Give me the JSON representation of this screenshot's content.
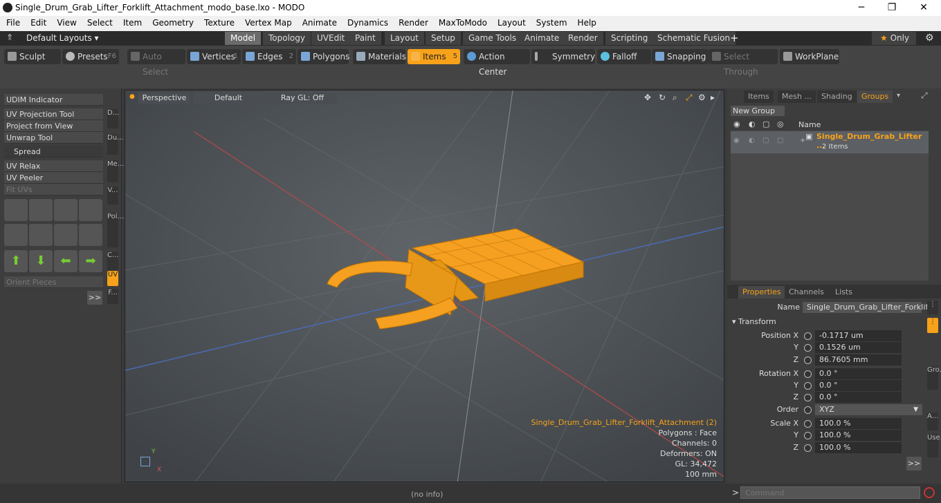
{
  "window": {
    "title": "Single_Drum_Grab_Lifter_Forklift_Attachment_modo_base.lxo - MODO",
    "minimize": "─",
    "maximize": "❐",
    "close": "✕"
  },
  "menu": [
    "File",
    "Edit",
    "View",
    "Select",
    "Item",
    "Geometry",
    "Texture",
    "Vertex Map",
    "Animate",
    "Dynamics",
    "Render",
    "MaxToModo",
    "Layout",
    "System",
    "Help"
  ],
  "layout_menu": "Default Layouts",
  "layout_tabs": [
    "Model",
    "Topology",
    "UVEdit",
    "Paint",
    "Layout",
    "Setup",
    "Game Tools",
    "Animate",
    "Render",
    "Scripting",
    "Schematic Fusion"
  ],
  "add_tab": "+",
  "only_label": "Only",
  "toolbar": {
    "sculpt": "Sculpt",
    "presets": "Presets",
    "presets_key": "F6",
    "auto_select": "Auto Select",
    "vertices": "Vertices",
    "vertices_key": "1",
    "edges": "Edges",
    "edges_key": "2",
    "polygons": "Polygons",
    "materials": "Materials",
    "items": "Items",
    "items_key": "5",
    "action_center": "Action Center",
    "symmetry": "Symmetry",
    "falloff": "Falloff",
    "snapping": "Snapping",
    "select_through": "Select Through",
    "workplane": "WorkPlane"
  },
  "left_tools": {
    "udim": "UDIM Indicator",
    "uv_projection": "UV Projection Tool",
    "project_from_view": "Project from View",
    "unwrap": "Unwrap Tool",
    "spread": "Spread",
    "uv_relax": "UV Relax",
    "uv_peeler": "UV Peeler",
    "fit_uvs": "Fit UVs",
    "orient_pieces": "Orient Pieces",
    "more": ">>"
  },
  "side_tabs": [
    "D...",
    "Du...",
    "Me...",
    "V...",
    "Pol...",
    "C...",
    "UV",
    "F..."
  ],
  "viewport": {
    "perspective": "Perspective",
    "default": "Default",
    "raygl": "Ray GL: Off",
    "selection_name": "Single_Drum_Grab_Lifter_Forklift_Attachment (2)",
    "polygons": "Polygons : Face",
    "channels": "Channels: 0",
    "deformers": "Deformers: ON",
    "gl": "GL: 34,472",
    "scale": "100 mm",
    "axis_y": "Y",
    "axis_x": "X"
  },
  "right_tabs": [
    "Items",
    "Mesh ...",
    "Shading",
    "Groups"
  ],
  "groups": {
    "new_group": "New Group",
    "col_name": "Name",
    "item_name": "Single_Drum_Grab_Lifter ...",
    "item_count": "2 Items"
  },
  "props_tabs": [
    "Properties",
    "Channels",
    "Lists"
  ],
  "properties": {
    "name_label": "Name",
    "name_value": "Single_Drum_Grab_Lifter_Forklift",
    "transform": "Transform",
    "position_x_label": "Position X",
    "position_x": "-0.1717 um",
    "position_y_label": "Y",
    "position_y": "0.1526 um",
    "position_z_label": "Z",
    "position_z": "86.7605 mm",
    "rotation_x_label": "Rotation X",
    "rotation_x": "0.0 °",
    "rotation_y_label": "Y",
    "rotation_y": "0.0 °",
    "rotation_z_label": "Z",
    "rotation_z": "0.0 °",
    "order_label": "Order",
    "order": "XYZ",
    "scale_x_label": "Scale X",
    "scale_x": "100.0 %",
    "scale_y_label": "Y",
    "scale_y": "100.0 %",
    "scale_z_label": "Z",
    "scale_z": "100.0 %",
    "more": ">>"
  },
  "props_side_tabs": [
    "Gro...",
    "A...",
    "Use..."
  ],
  "status": {
    "info": "(no info)",
    "command_placeholder": "Command",
    "prompt": ">"
  },
  "colors": {
    "accent": "#f7a21a",
    "mesh": "#f5a020"
  }
}
